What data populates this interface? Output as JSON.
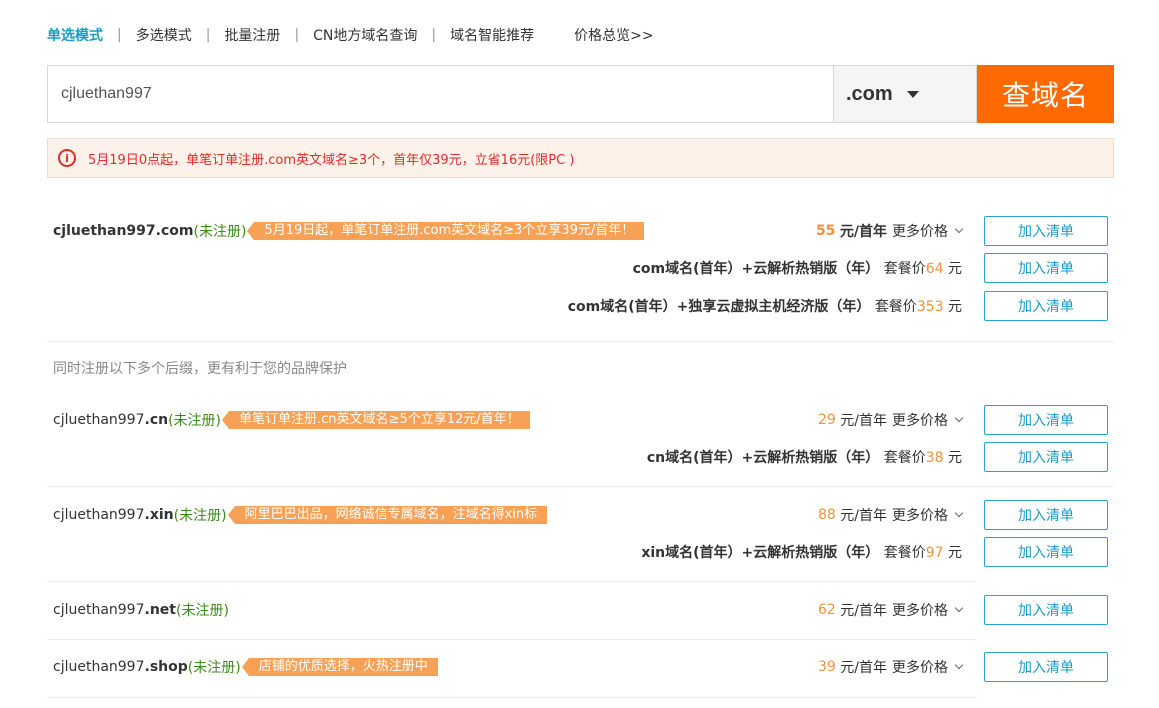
{
  "tabs": {
    "items": [
      {
        "label": "单选模式"
      },
      {
        "label": "多选模式"
      },
      {
        "label": "批量注册"
      },
      {
        "label": "CN地方域名查询"
      },
      {
        "label": "域名智能推荐"
      }
    ],
    "separator": "|",
    "price_overview": "价格总览>>"
  },
  "search": {
    "value": "cjluethan997",
    "tld": ".com",
    "button": "查域名"
  },
  "notice": {
    "icon": "i",
    "text": "5月19日0点起，单笔订单注册.com英文域名≥3个，首年仅39元，立省16元(限PC )"
  },
  "common": {
    "add_button": "加入清单",
    "more_prices": "更多价格",
    "unit_yuan_first_year": "元/首年",
    "bundle_price_label": "套餐价",
    "yuan": "元"
  },
  "brand_note": "同时注册以下多个后缀，更有利于您的品牌保护",
  "results": [
    {
      "name": "cjluethan997",
      "tld": ".com",
      "status": "(未注册)",
      "promo": "5月19日起，单笔订单注册.com英文域名≥3个立享39元/首年！",
      "price": "55",
      "bundles": [
        {
          "name": "com域名(首年）+云解析热销版（年）",
          "price": "64"
        },
        {
          "name": "com域名(首年）+独享云虚拟主机经济版（年）",
          "price": "353"
        }
      ]
    },
    {
      "name": "cjluethan997",
      "tld": ".cn",
      "status": "(未注册)",
      "promo": "单笔订单注册.cn英文域名≥5个立享12元/首年！",
      "price": "29",
      "bundles": [
        {
          "name": "cn域名(首年）+云解析热销版（年）",
          "price": "38"
        }
      ]
    },
    {
      "name": "cjluethan997",
      "tld": ".xin",
      "status": "(未注册)",
      "promo": "阿里巴巴出品，网络诚信专属域名，注域名得xin标",
      "price": "88",
      "bundles": [
        {
          "name": "xin域名(首年）+云解析热销版（年）",
          "price": "97"
        }
      ]
    },
    {
      "name": "cjluethan997",
      "tld": ".net",
      "status": "(未注册)",
      "promo": "",
      "price": "62",
      "bundles": []
    },
    {
      "name": "cjluethan997",
      "tld": ".shop",
      "status": "(未注册)",
      "promo": "店铺的优质选择，火热注册中",
      "price": "39",
      "bundles": []
    }
  ]
}
